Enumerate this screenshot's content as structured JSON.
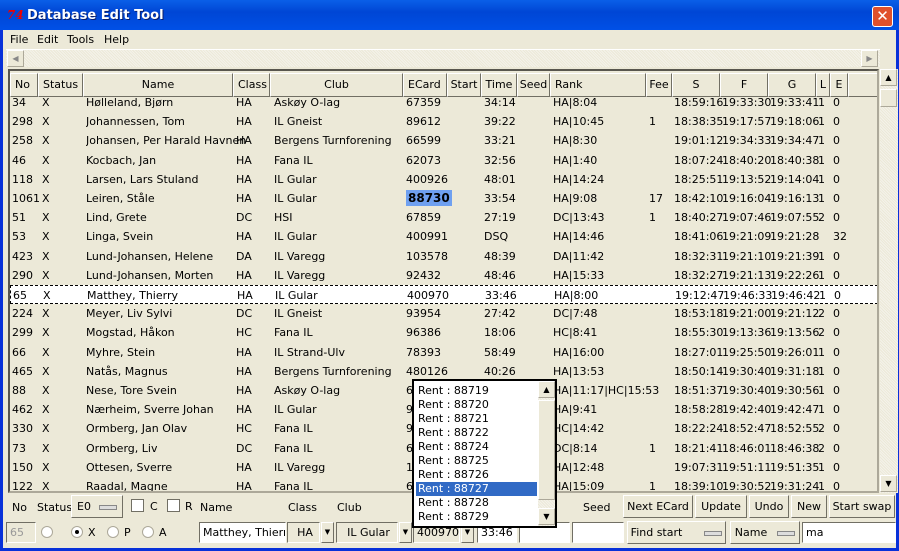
{
  "window": {
    "title": "Database Edit Tool",
    "logo": "74",
    "close_icon": "close-icon"
  },
  "menu": [
    "File",
    "Edit",
    "Tools",
    "Help"
  ],
  "columns": [
    "No",
    "Status",
    "Name",
    "Class",
    "Club",
    "ECard",
    "Start",
    "Time",
    "Seed",
    "Rank",
    "Fee",
    "S",
    "F",
    "G",
    "L",
    "E"
  ],
  "rows": [
    [
      "34",
      "X",
      "Hølleland, Bjørn",
      "HA",
      "Askøy O-lag",
      "67359",
      "",
      "34:14",
      "",
      "HA|8:04",
      "",
      "18:59:16",
      "19:33:30",
      "19:33:41",
      "1",
      "0"
    ],
    [
      "298",
      "X",
      "Johannessen, Tom",
      "HA",
      "IL Gneist",
      "89612",
      "",
      "39:22",
      "",
      "HA|10:45",
      "1",
      "18:38:35",
      "19:17:57",
      "19:18:06",
      "1",
      "0"
    ],
    [
      "258",
      "X",
      "Johansen, Per Harald Havnen",
      "HA",
      "Bergens Turnforening",
      "66599",
      "",
      "33:21",
      "",
      "HA|8:30",
      "",
      "19:01:12",
      "19:34:33",
      "19:34:47",
      "1",
      "0"
    ],
    [
      "46",
      "X",
      "Kocbach, Jan",
      "HA",
      "Fana IL",
      "62073",
      "",
      "32:56",
      "",
      "HA|1:40",
      "",
      "18:07:24",
      "18:40:20",
      "18:40:38",
      "1",
      "0"
    ],
    [
      "118",
      "X",
      "Larsen, Lars Stuland",
      "HA",
      "IL Gular",
      "400926",
      "",
      "48:01",
      "",
      "HA|14:24",
      "",
      "18:25:51",
      "19:13:52",
      "19:14:04",
      "1",
      "0"
    ],
    [
      "1061",
      "X",
      "Leiren, Ståle",
      "HA",
      "IL Gular",
      "88730",
      "",
      "33:54",
      "",
      "HA|9:08",
      "17",
      "18:42:10",
      "19:16:04",
      "19:16:13",
      "1",
      "0"
    ],
    [
      "51",
      "X",
      "Lind, Grete",
      "DC",
      "HSI",
      "67859",
      "",
      "27:19",
      "",
      "DC|13:43",
      "1",
      "18:40:27",
      "19:07:46",
      "19:07:55",
      "2",
      "0"
    ],
    [
      "53",
      "X",
      "Linga, Svein",
      "HA",
      "IL Gular",
      "400991",
      "",
      "DSQ",
      "",
      "HA|14:46",
      "",
      "18:41:06",
      "19:21:09",
      "19:21:28",
      "",
      "32"
    ],
    [
      "423",
      "X",
      "Lund-Johansen, Helene",
      "DA",
      "IL Varegg",
      "103578",
      "",
      "48:39",
      "",
      "DA|11:42",
      "",
      "18:32:31",
      "19:21:10",
      "19:21:39",
      "1",
      "0"
    ],
    [
      "290",
      "X",
      "Lund-Johansen, Morten",
      "HA",
      "IL Varegg",
      "92432",
      "",
      "48:46",
      "",
      "HA|15:33",
      "",
      "18:32:27",
      "19:21:13",
      "19:22:26",
      "1",
      "0"
    ],
    [
      "65",
      "X",
      "Matthey, Thierry",
      "HA",
      "IL Gular",
      "400970",
      "",
      "33:46",
      "",
      "HA|8:00",
      "",
      "19:12:47",
      "19:46:33",
      "19:46:42",
      "1",
      "0"
    ],
    [
      "224",
      "X",
      "Meyer, Liv Sylvi",
      "DC",
      "IL Gneist",
      "93954",
      "",
      "27:42",
      "",
      "DC|7:48",
      "",
      "18:53:18",
      "19:21:00",
      "19:21:12",
      "2",
      "0"
    ],
    [
      "299",
      "X",
      "Mogstad, Håkon",
      "HC",
      "Fana IL",
      "96386",
      "",
      "18:06",
      "",
      "HC|8:41",
      "",
      "18:55:30",
      "19:13:36",
      "19:13:56",
      "2",
      "0"
    ],
    [
      "66",
      "X",
      "Myhre, Stein",
      "HA",
      "IL Strand-Ulv",
      "78393",
      "",
      "58:49",
      "",
      "HA|16:00",
      "",
      "18:27:01",
      "19:25:50",
      "19:26:01",
      "1",
      "0"
    ],
    [
      "465",
      "X",
      "Natås, Magnus",
      "HA",
      "Bergens Turnforening",
      "480126",
      "",
      "40:26",
      "",
      "HA|13:53",
      "",
      "18:50:14",
      "19:30:40",
      "19:31:18",
      "1",
      "0"
    ],
    [
      "88",
      "X",
      "Nese, Tore Svein",
      "HA",
      "Askøy O-lag",
      "6",
      "",
      "",
      "",
      "HA|11:17|HC|15:53",
      "",
      "18:51:37",
      "19:30:40",
      "19:30:56",
      "1",
      "0"
    ],
    [
      "462",
      "X",
      "Nærheim, Sverre Johan",
      "HA",
      "IL Gular",
      "9",
      "",
      "",
      "",
      "HA|9:41",
      "",
      "18:58:28",
      "19:42:40",
      "19:42:47",
      "1",
      "0"
    ],
    [
      "330",
      "X",
      "Ormberg, Jan Olav",
      "HC",
      "Fana IL",
      "9",
      "",
      "",
      "",
      "HC|14:42",
      "",
      "18:22:24",
      "18:52:47",
      "18:52:55",
      "2",
      "0"
    ],
    [
      "73",
      "X",
      "Ormberg, Liv",
      "DC",
      "Fana IL",
      "6",
      "",
      "",
      "",
      "DC|8:14",
      "1",
      "18:21:41",
      "18:46:01",
      "18:46:38",
      "2",
      "0"
    ],
    [
      "150",
      "X",
      "Ottesen, Sverre",
      "HA",
      "IL Varegg",
      "1",
      "",
      "",
      "",
      "HA|12:48",
      "",
      "19:07:31",
      "19:51:11",
      "19:51:35",
      "1",
      "0"
    ],
    [
      "122",
      "X",
      "Raadal, Magne",
      "HA",
      "Fana IL",
      "6",
      "",
      "",
      "",
      "HA|15:09",
      "1",
      "18:39:10",
      "19:30:52",
      "19:31:24",
      "1",
      "0"
    ]
  ],
  "selected_row": "65",
  "highlighted_ecard": "88730",
  "dropdown": {
    "items": [
      "Rent : 88719",
      "Rent : 88720",
      "Rent : 88721",
      "Rent : 88722",
      "Rent : 88724",
      "Rent : 88725",
      "Rent : 88726",
      "Rent : 88727",
      "Rent : 88728",
      "Rent : 88729"
    ],
    "selected": "Rent : 88727"
  },
  "form": {
    "labels": {
      "no": "No",
      "status": "Status",
      "name": "Name",
      "class": "Class",
      "club": "Club",
      "seed": "Seed",
      "c": "C",
      "r": "R"
    },
    "status_value": "E0",
    "no_value": "65",
    "radios": {
      "x": "X",
      "p": "P",
      "a": "A",
      "selected": "X"
    },
    "name_value": "Matthey, Thierry",
    "class_value": "HA",
    "club_value": "IL Gular",
    "ecard_value": "400970",
    "time_value": "33:46",
    "start_value": "",
    "seed_value": "",
    "buttons": {
      "next_ecard": "Next ECard",
      "update": "Update",
      "undo": "Undo",
      "new": "New",
      "start_swap": "Start swap",
      "find_start": "Find start",
      "name_sort": "Name"
    },
    "search_value": "ma"
  }
}
